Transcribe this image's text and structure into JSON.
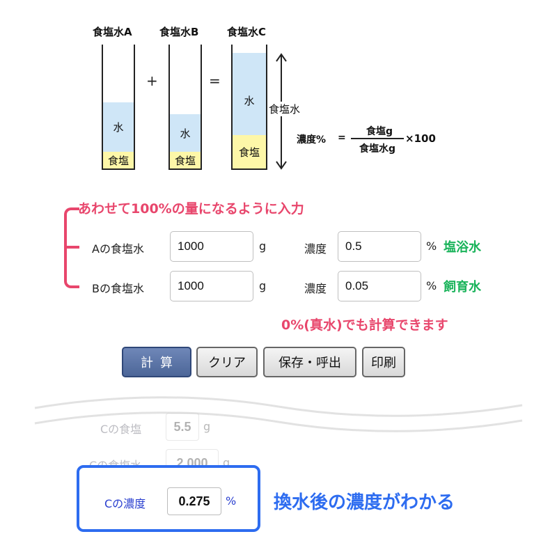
{
  "diagram": {
    "beaker_a_title": "食塩水A",
    "beaker_b_title": "食塩水B",
    "beaker_c_title": "食塩水C",
    "water_label": "水",
    "salt_label": "食塩",
    "plus": "+",
    "equals": "=",
    "total_label": "食塩水",
    "formula_lhs": "濃度%",
    "formula_eq": "=",
    "formula_num": "食塩g",
    "formula_den": "食塩水g",
    "formula_tail": "×100"
  },
  "hints": {
    "combine": "あわせて100%の量になるように入力",
    "zero_note": "0%(真水)でも計算できます",
    "result_note": "換水後の濃度がわかる"
  },
  "inputs": {
    "a_label": "Aの食塩水",
    "a_value": "1000",
    "a_unit": "g",
    "a_conc_label": "濃度",
    "a_conc_value": "0.5",
    "a_conc_unit": "%",
    "a_tag": "塩浴水",
    "b_label": "Bの食塩水",
    "b_value": "1000",
    "b_unit": "g",
    "b_conc_label": "濃度",
    "b_conc_value": "0.05",
    "b_conc_unit": "%",
    "b_tag": "飼育水"
  },
  "buttons": {
    "calc": "計算",
    "clear": "クリア",
    "save": "保存・呼出",
    "print": "印刷"
  },
  "results": {
    "salt_label": "Cの食塩",
    "salt_value": "5.5",
    "salt_unit": "g",
    "water_label": "Cの食塩水",
    "water_value": "2,000",
    "water_unit": "g",
    "conc_label": "Cの濃度",
    "conc_value": "0.275",
    "conc_unit": "%"
  },
  "colors": {
    "hint_red": "#e8466c",
    "tag_green": "#19b35a",
    "highlight_blue": "#2d6cf0",
    "water_fill": "#cfe6f7",
    "salt_fill": "#fdf7a8",
    "calc_button": "#5a73a6"
  }
}
